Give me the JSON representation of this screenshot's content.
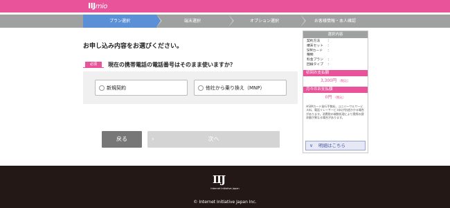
{
  "header": {
    "logo_main": "IIJ",
    "logo_sub": "mio"
  },
  "steps": [
    {
      "label": "プラン選択",
      "active": true
    },
    {
      "label": "端末選択",
      "active": false
    },
    {
      "label": "オプション選択",
      "active": false
    },
    {
      "label": "お客様情報・本人確認",
      "active": false
    }
  ],
  "main": {
    "title": "お申し込み内容をお選びください。",
    "required_badge": "必須",
    "question": "現在の携帯電話の電話番号はそのまま使いますか？",
    "options": [
      {
        "label": "新規契約",
        "selected": false
      },
      {
        "label": "他社から乗り換え（MNP）",
        "selected": false
      }
    ],
    "back_label": "戻る",
    "next_label": "次へ"
  },
  "sidebar": {
    "header": "選択内容",
    "rows": [
      {
        "key": "契約方法",
        "value": "："
      },
      {
        "key": "端末セット",
        "value": "："
      },
      {
        "key": "SIMカード",
        "value": "："
      },
      {
        "key": "種類",
        "value": ""
      },
      {
        "key": "料金プラン",
        "value": "："
      },
      {
        "key": "回線タイプ",
        "value": "："
      }
    ],
    "initial_label": "初回お支払額",
    "initial_amount": "3,300円",
    "initial_tax": "（税込）",
    "monthly_label": "月々のお支払額",
    "monthly_amount": "0円",
    "monthly_tax": "（税込）",
    "note": "※SIMカード発行手数料、ユニバーサルサービス料、電話リレーサービス料が別途かかる場合があります。消費税の端数処理により実際の請求額が異なる場合があります。",
    "detail_label": "明細はこちら"
  },
  "footer": {
    "logo": "IIJ",
    "logo_sub": "Internet Initiative Japan",
    "copyright": "© Internet Initiative Japan Inc."
  },
  "colors": {
    "brand_pink": "#e8539a",
    "step_active": "#5b8fd6",
    "step_inactive": "#9fa0a0",
    "footer_bg": "#231815"
  }
}
